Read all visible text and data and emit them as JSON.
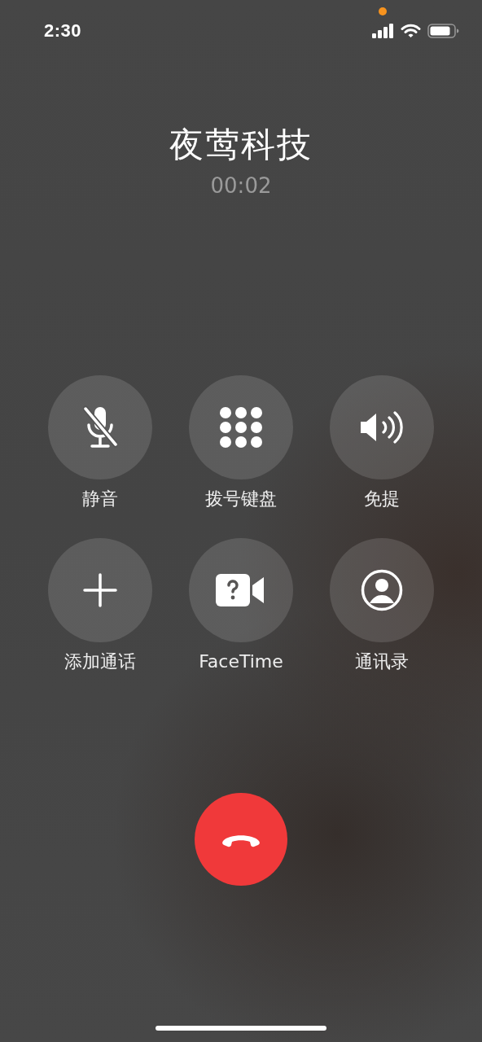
{
  "status_bar": {
    "time": "2:30"
  },
  "call": {
    "name": "夜莺科技",
    "duration": "00:02"
  },
  "controls": [
    {
      "kind": "mute",
      "label": "静音",
      "on": false
    },
    {
      "kind": "keypad",
      "label": "拨号键盘",
      "on": false
    },
    {
      "kind": "speaker",
      "label": "免提",
      "on": false
    },
    {
      "kind": "add",
      "label": "添加通话",
      "on": false
    },
    {
      "kind": "facetime",
      "label": "FaceTime",
      "on": false
    },
    {
      "kind": "contacts",
      "label": "通讯录",
      "on": false
    }
  ]
}
